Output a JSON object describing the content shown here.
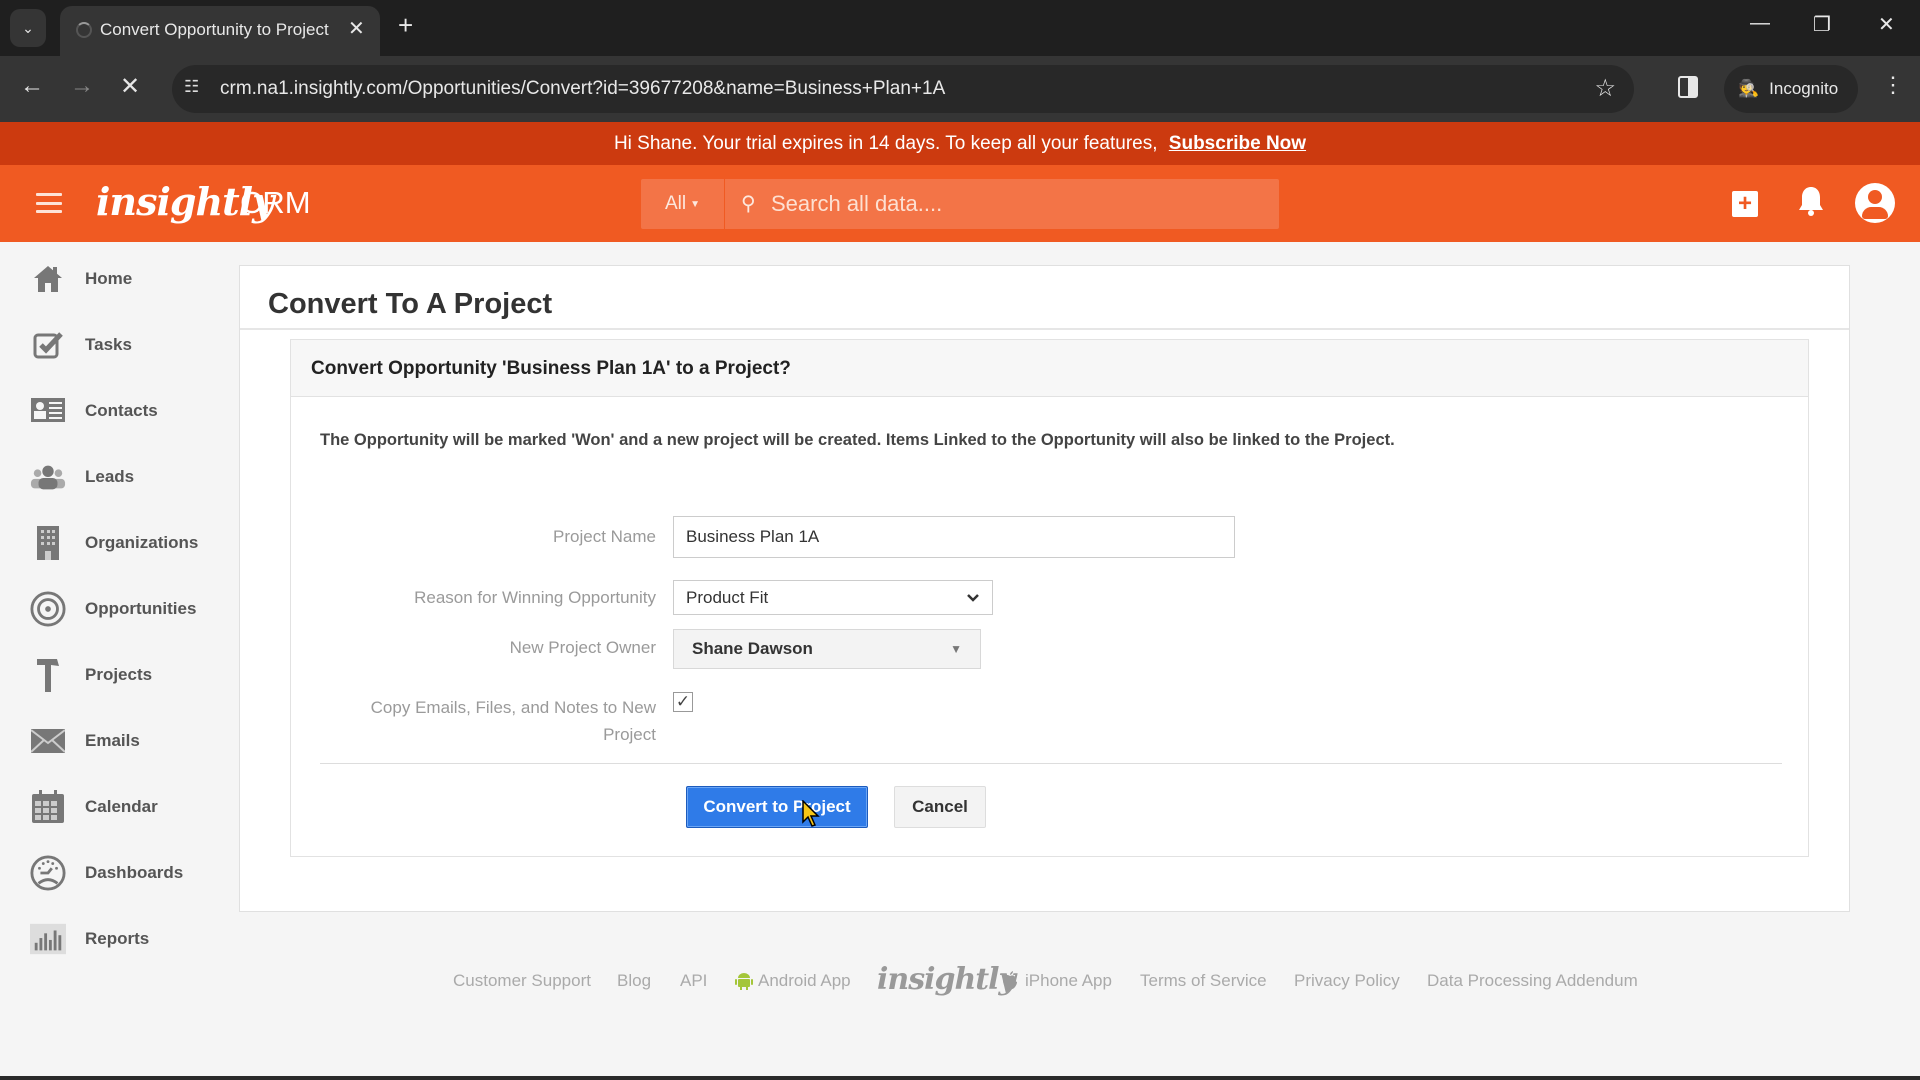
{
  "browser": {
    "tab_title": "Convert Opportunity to Project",
    "url": "crm.na1.insightly.com/Opportunities/Convert?id=39677208&name=Business+Plan+1A",
    "incognito_label": "Incognito"
  },
  "banner": {
    "message": "Hi Shane. Your trial expires in 14 days. To keep all your features,",
    "link": "Subscribe Now"
  },
  "header": {
    "logo": "insightly",
    "product": "CRM",
    "search_scope": "All",
    "search_placeholder": "Search all data...."
  },
  "sidebar": {
    "items": [
      {
        "label": "Home",
        "icon": "home-icon"
      },
      {
        "label": "Tasks",
        "icon": "tasks-icon"
      },
      {
        "label": "Contacts",
        "icon": "contacts-icon"
      },
      {
        "label": "Leads",
        "icon": "leads-icon"
      },
      {
        "label": "Organizations",
        "icon": "organizations-icon"
      },
      {
        "label": "Opportunities",
        "icon": "opportunities-icon"
      },
      {
        "label": "Projects",
        "icon": "projects-icon"
      },
      {
        "label": "Emails",
        "icon": "emails-icon"
      },
      {
        "label": "Calendar",
        "icon": "calendar-icon"
      },
      {
        "label": "Dashboards",
        "icon": "dashboards-icon"
      },
      {
        "label": "Reports",
        "icon": "reports-icon"
      }
    ]
  },
  "page": {
    "title": "Convert To A Project",
    "panel_title": "Convert Opportunity 'Business Plan 1A' to a Project?",
    "description": "The Opportunity will be marked 'Won' and a new project will be created. Items Linked to the Opportunity will also be linked to the Project.",
    "form": {
      "project_name_label": "Project Name",
      "project_name_value": "Business Plan 1A",
      "reason_label": "Reason for Winning Opportunity",
      "reason_value": "Product Fit",
      "owner_label": "New Project Owner",
      "owner_value": "Shane Dawson",
      "copy_label_line1": "Copy Emails, Files, and Notes to New",
      "copy_label_line2": "Project",
      "copy_checked": true
    },
    "buttons": {
      "convert": "Convert to Project",
      "cancel": "Cancel"
    }
  },
  "footer": {
    "links": [
      "Customer Support",
      "Blog",
      "API",
      "Android App",
      "iPhone App",
      "Terms of Service",
      "Privacy Policy",
      "Data Processing Addendum"
    ],
    "logo": "insightly"
  },
  "colors": {
    "brand_orange": "#f05a22",
    "banner_red": "#cc3a0f",
    "primary_blue": "#2f7be8",
    "android_green": "#a4c639"
  }
}
